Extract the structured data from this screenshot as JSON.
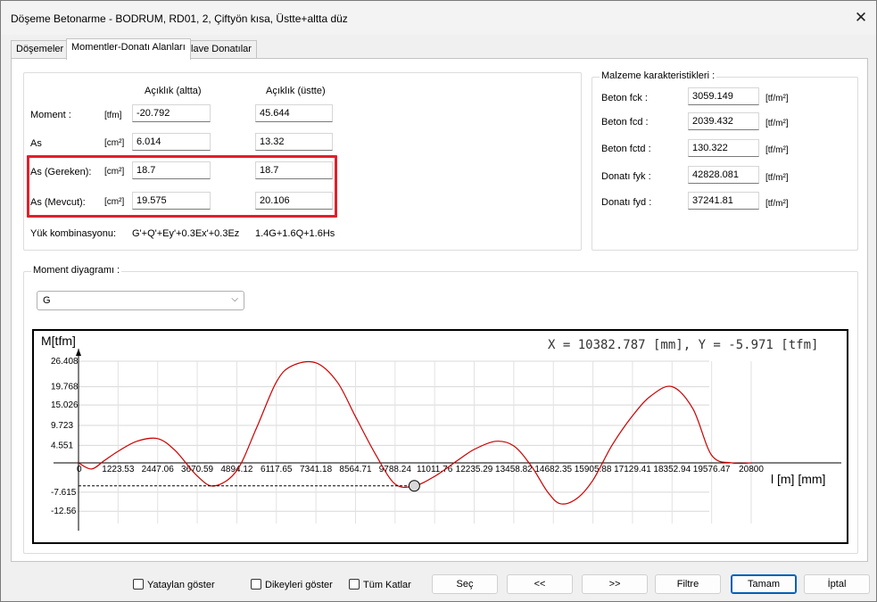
{
  "window": {
    "title": "Döşeme Betonarme - BODRUM, RD01, 2, Çiftyön kısa, Üstte+altta düz",
    "close_glyph": "✕"
  },
  "tabs": [
    {
      "label": "Döşemeler"
    },
    {
      "label": "Momentler-Donatı Alanları"
    },
    {
      "label": "İlave Donatılar"
    }
  ],
  "moments": {
    "col_bottom": "Açıklık (altta)",
    "col_top": "Açıklık (üstte)",
    "rows": [
      {
        "label": "Moment :",
        "unit": "[tfm]",
        "bottom": "-20.792",
        "top": "45.644"
      },
      {
        "label": "As",
        "unit": "[cm²]",
        "bottom": "6.014",
        "top": "13.32"
      },
      {
        "label": "As (Gereken):",
        "unit": "[cm²]",
        "bottom": "18.7",
        "top": "18.7"
      },
      {
        "label": "As (Mevcut):",
        "unit": "[cm²]",
        "bottom": "19.575",
        "top": "20.106"
      }
    ],
    "combination_label": "Yük kombinasyonu:",
    "combination_bottom": "G'+Q'+Ey'+0.3Ex'+0.3Ez",
    "combination_top": "1.4G+1.6Q+1.6Hs"
  },
  "material": {
    "legend": "Malzeme karakteristikleri :",
    "rows": [
      {
        "label": "Beton fck :",
        "value": "3059.149",
        "unit": "[tf/m²]"
      },
      {
        "label": "Beton fcd :",
        "value": "2039.432",
        "unit": "[tf/m²]"
      },
      {
        "label": "Beton fctd :",
        "value": "130.322",
        "unit": "[tf/m²]"
      },
      {
        "label": "Donatı fyk :",
        "value": "42828.081",
        "unit": "[tf/m²]"
      },
      {
        "label": "Donatı fyd :",
        "value": "37241.81",
        "unit": "[tf/m²]"
      }
    ]
  },
  "diagram": {
    "legend": "Moment diyagramı :",
    "combo_value": "G",
    "combo_icon": "chevron-down-icon",
    "readout": "X = 10382.787 [mm],  Y = -5.971 [tfm]"
  },
  "chart_data": {
    "type": "line",
    "ylabel": "M[tfm]",
    "xlabel": "l [m] [mm]",
    "y_ticks": [
      "26.408",
      "19.768",
      "15.026",
      "9.723",
      "4.551",
      "-7.615",
      "-12.56"
    ],
    "x_ticks": [
      "0",
      "1223.53",
      "2447.06",
      "3670.59",
      "4894.12",
      "6117.65",
      "7341.18",
      "8564.71",
      "9788.24",
      "11011.76",
      "12235.29",
      "13458.82",
      "14682.35",
      "15905.88",
      "17129.41",
      "18352.94",
      "19576.47",
      "20800"
    ],
    "xlim": [
      0,
      20800
    ],
    "ylim": [
      -12.56,
      26.408
    ],
    "series": [
      {
        "color": "#cc0000",
        "x": [
          0,
          400,
          800,
          1223.53,
          1800,
          2447.06,
          3000,
          3670.59,
          4200,
          4894.12,
          5500,
          6117.65,
          6600,
          7341.18,
          8000,
          8564.71,
          9200,
          9788.24,
          10382.787,
          11011.76,
          11700,
          12235.29,
          12900,
          13458.82,
          14000,
          14500,
          14900,
          15400,
          15905.88,
          16500,
          17129.41,
          17700,
          18352.94,
          19000,
          19576.47,
          20200,
          20800
        ],
        "y": [
          0,
          -1.6,
          0.6,
          3.0,
          5.6,
          6.3,
          3.1,
          -3.4,
          -6.0,
          -2.0,
          9.0,
          21.0,
          25.2,
          26.0,
          21.0,
          12.0,
          2.0,
          -5.5,
          -5.971,
          -3.5,
          0.5,
          3.5,
          5.6,
          4.4,
          -0.8,
          -7.5,
          -10.6,
          -9.3,
          -4.5,
          4.6,
          12.2,
          17.4,
          19.8,
          14.0,
          2.0,
          0.0,
          0.0
        ]
      }
    ],
    "cursor": {
      "x": 10382.787,
      "y": -5.971
    },
    "grid": true
  },
  "bottom": {
    "show_horizontal": "Yataylan göster",
    "show_vertical": "Dikeyleri göster",
    "all_floors": "Tüm Katlar",
    "select": "Seç",
    "prev": "<<",
    "next": ">>",
    "filter": "Filtre",
    "ok": "Tamam",
    "cancel": "İptal"
  }
}
